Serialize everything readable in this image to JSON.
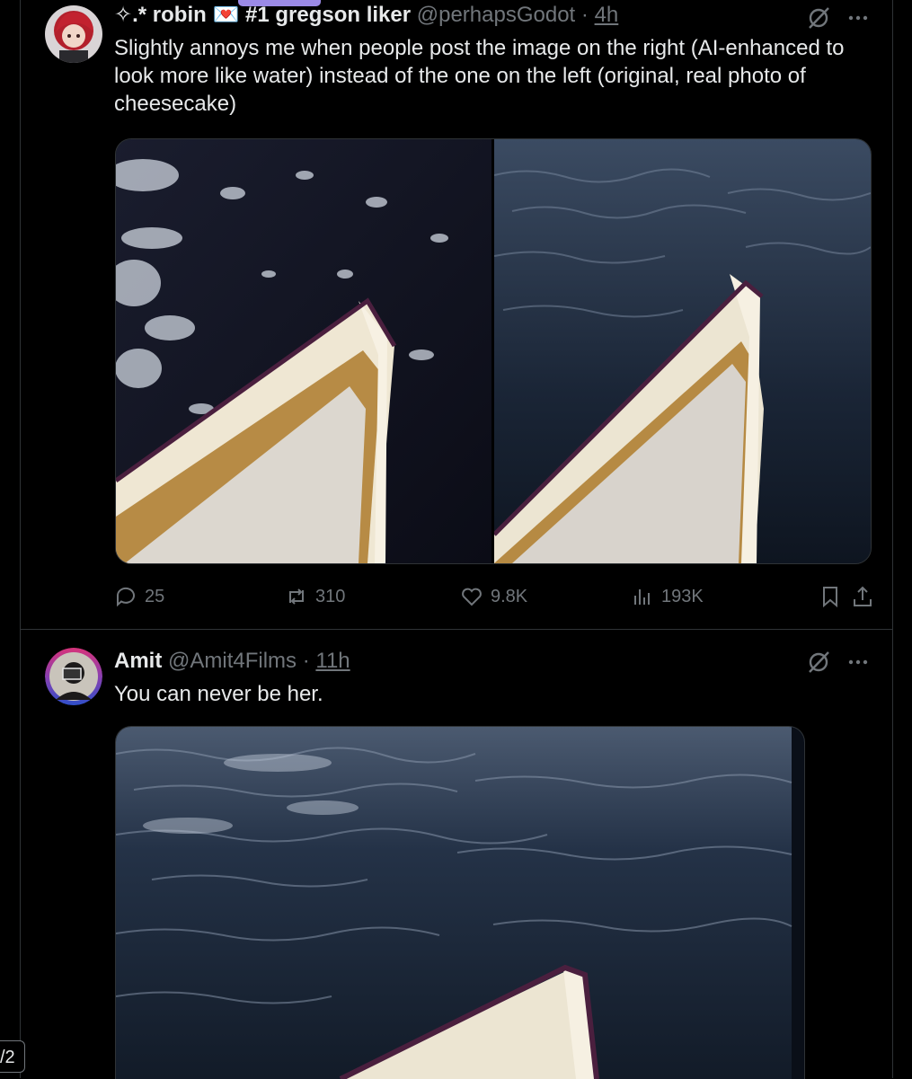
{
  "tweets": [
    {
      "display_name": "✧.* robin 💌 #1 gregson liker",
      "handle": "@perhapsGodot",
      "separator": "·",
      "time": "4h",
      "text": "Slightly annoys me when people post the image on the right (AI-enhanced to look more like water) instead of the one on the left (original, real photo of cheesecake)",
      "media": [
        {
          "description": "cheesecake-slice-original-photo"
        },
        {
          "description": "cheesecake-slice-ai-enhanced-water"
        }
      ],
      "actions": {
        "replies": "25",
        "reposts": "310",
        "likes": "9.8K",
        "views": "193K"
      }
    },
    {
      "display_name": "Amit",
      "handle": "@Amit4Films",
      "separator": "·",
      "time": "11h",
      "text": "You can never be her.",
      "media": [
        {
          "description": "cheesecake-slice-on-ocean-water"
        }
      ]
    }
  ],
  "page_indicator": "/2",
  "colors": {
    "background": "#000000",
    "text_primary": "#e7e9ea",
    "text_secondary": "#71767b",
    "border": "#2f3336",
    "scroll_indicator": "#9b8ae6"
  },
  "icons": [
    "reply-icon",
    "repost-icon",
    "like-icon",
    "views-icon",
    "bookmark-icon",
    "share-icon",
    "grok-icon",
    "more-icon"
  ]
}
